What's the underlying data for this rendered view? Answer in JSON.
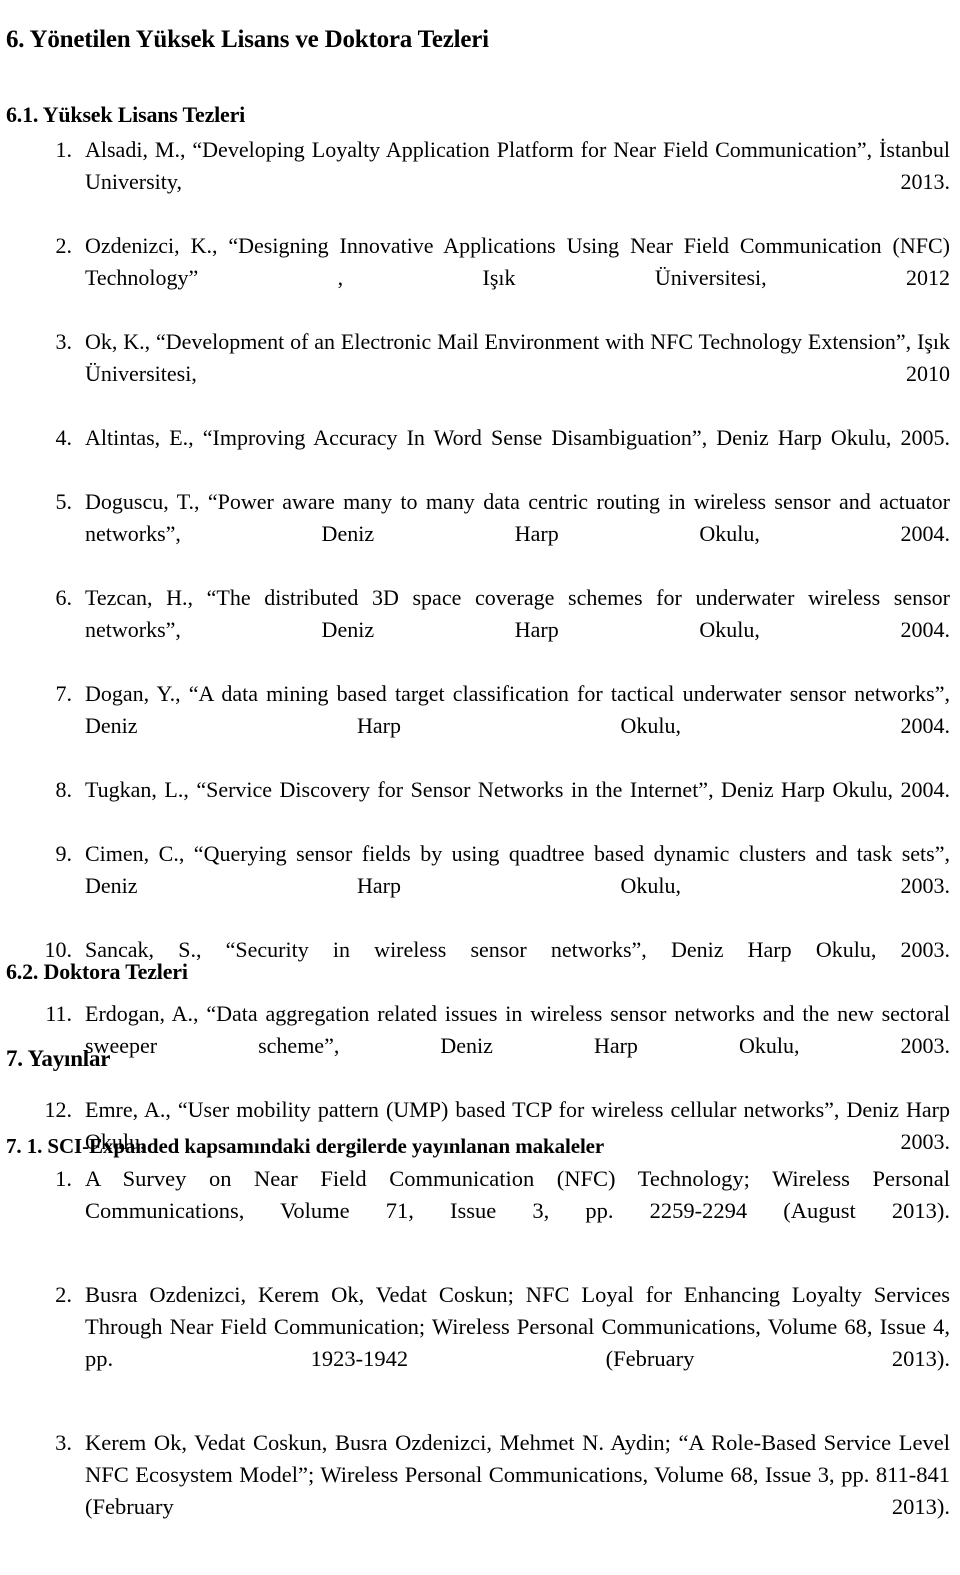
{
  "document": {
    "headings": {
      "section_6": "6. Yönetilen Yüksek Lisans ve Doktora Tezleri",
      "section_6_1": "6.1. Yüksek Lisans Tezleri",
      "section_6_2": "6.2. Doktora Tezleri",
      "section_7": "7. Yayınlar",
      "section_7_1": "7. 1.  SCI-Expanded kapsamındaki dergilerde yayınlanan makaleler"
    },
    "masters_theses": [
      {
        "number": "1.",
        "text": "Alsadi, M., “Developing Loyalty Application Platform for Near Field Communication”, İstanbul University, 2013."
      },
      {
        "number": "2.",
        "text": "Ozdenizci, K., “Designing Innovative Applications Using Near Field Communication (NFC) Technology” , Işık Üniversitesi, 2012"
      },
      {
        "number": "3.",
        "text": "Ok, K., “Development of an Electronic Mail Environment with NFC Technology Extension”, Işık Üniversitesi, 2010"
      },
      {
        "number": "4.",
        "text": "Altintas, E., “Improving Accuracy In Word Sense Disambiguation”, Deniz Harp Okulu, 2005."
      },
      {
        "number": "5.",
        "text": "Doguscu, T., “Power aware many to many data centric routing in wireless sensor and actuator networks”, Deniz Harp Okulu, 2004."
      },
      {
        "number": "6.",
        "text": "Tezcan, H., “The distributed 3D space coverage schemes for underwater wireless sensor networks”, Deniz Harp Okulu, 2004."
      },
      {
        "number": "7.",
        "text": "Dogan, Y., “A data mining based target classification for tactical underwater sensor networks”, Deniz Harp Okulu, 2004."
      },
      {
        "number": "8.",
        "text": "Tugkan, L., “Service Discovery for Sensor Networks in the Internet”, Deniz Harp Okulu, 2004."
      },
      {
        "number": "9.",
        "text": "Cimen, C., “Querying sensor fields by using quadtree based dynamic clusters and task sets”, Deniz Harp Okulu, 2003."
      },
      {
        "number": "10.",
        "text": "Sancak, S., “Security in wireless sensor networks”, Deniz Harp Okulu, 2003."
      },
      {
        "number": "11.",
        "text": "Erdogan, A., “Data aggregation related issues in wireless sensor networks and the new sectoral sweeper scheme”, Deniz Harp Okulu, 2003."
      },
      {
        "number": "12.",
        "text": "Emre, A., “User mobility pattern (UMP) based TCP for wireless cellular networks”, Deniz Harp Okulu, 2003."
      }
    ],
    "publications": [
      {
        "number": "1.",
        "text": "A Survey on Near Field Communication (NFC) Technology; Wireless Personal Communications, Volume 71, Issue 3, pp. 2259-2294 (August 2013)."
      },
      {
        "number": "2.",
        "text": "Busra Ozdenizci, Kerem Ok, Vedat Coskun; NFC Loyal for Enhancing Loyalty Services Through Near Field Communication; Wireless Personal Communications, Volume 68, Issue 4, pp. 1923-1942 (February 2013)."
      },
      {
        "number": "3.",
        "text": "Kerem Ok, Vedat Coskun, Busra Ozdenizci, Mehmet N. Aydin; “A Role-Based Service Level NFC Ecosystem Model”; Wireless Personal Communications, Volume 68, Issue 3, pp. 811-841 (February 2013)."
      }
    ]
  }
}
